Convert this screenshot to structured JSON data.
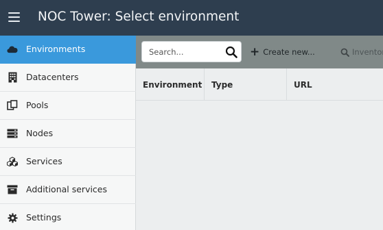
{
  "header": {
    "title": "NOC Tower: Select environment"
  },
  "sidebar": {
    "items": [
      {
        "label": "Environments",
        "icon": "cloud-icon",
        "active": true
      },
      {
        "label": "Datacenters",
        "icon": "building-icon",
        "active": false
      },
      {
        "label": "Pools",
        "icon": "pools-icon",
        "active": false
      },
      {
        "label": "Nodes",
        "icon": "server-icon",
        "active": false
      },
      {
        "label": "Services",
        "icon": "cubes-icon",
        "active": false
      },
      {
        "label": "Additional services",
        "icon": "archive-icon",
        "active": false
      },
      {
        "label": "Settings",
        "icon": "gear-icon",
        "active": false
      }
    ]
  },
  "toolbar": {
    "search_placeholder": "Search...",
    "create_label": "Create new...",
    "inventory_label": "Inventory"
  },
  "table": {
    "columns": [
      "Environment",
      "Type",
      "URL"
    ],
    "rows": []
  },
  "colors": {
    "topbar": "#2e3e4f",
    "sidebar_active": "#3a99dc",
    "toolbar": "#808988"
  }
}
